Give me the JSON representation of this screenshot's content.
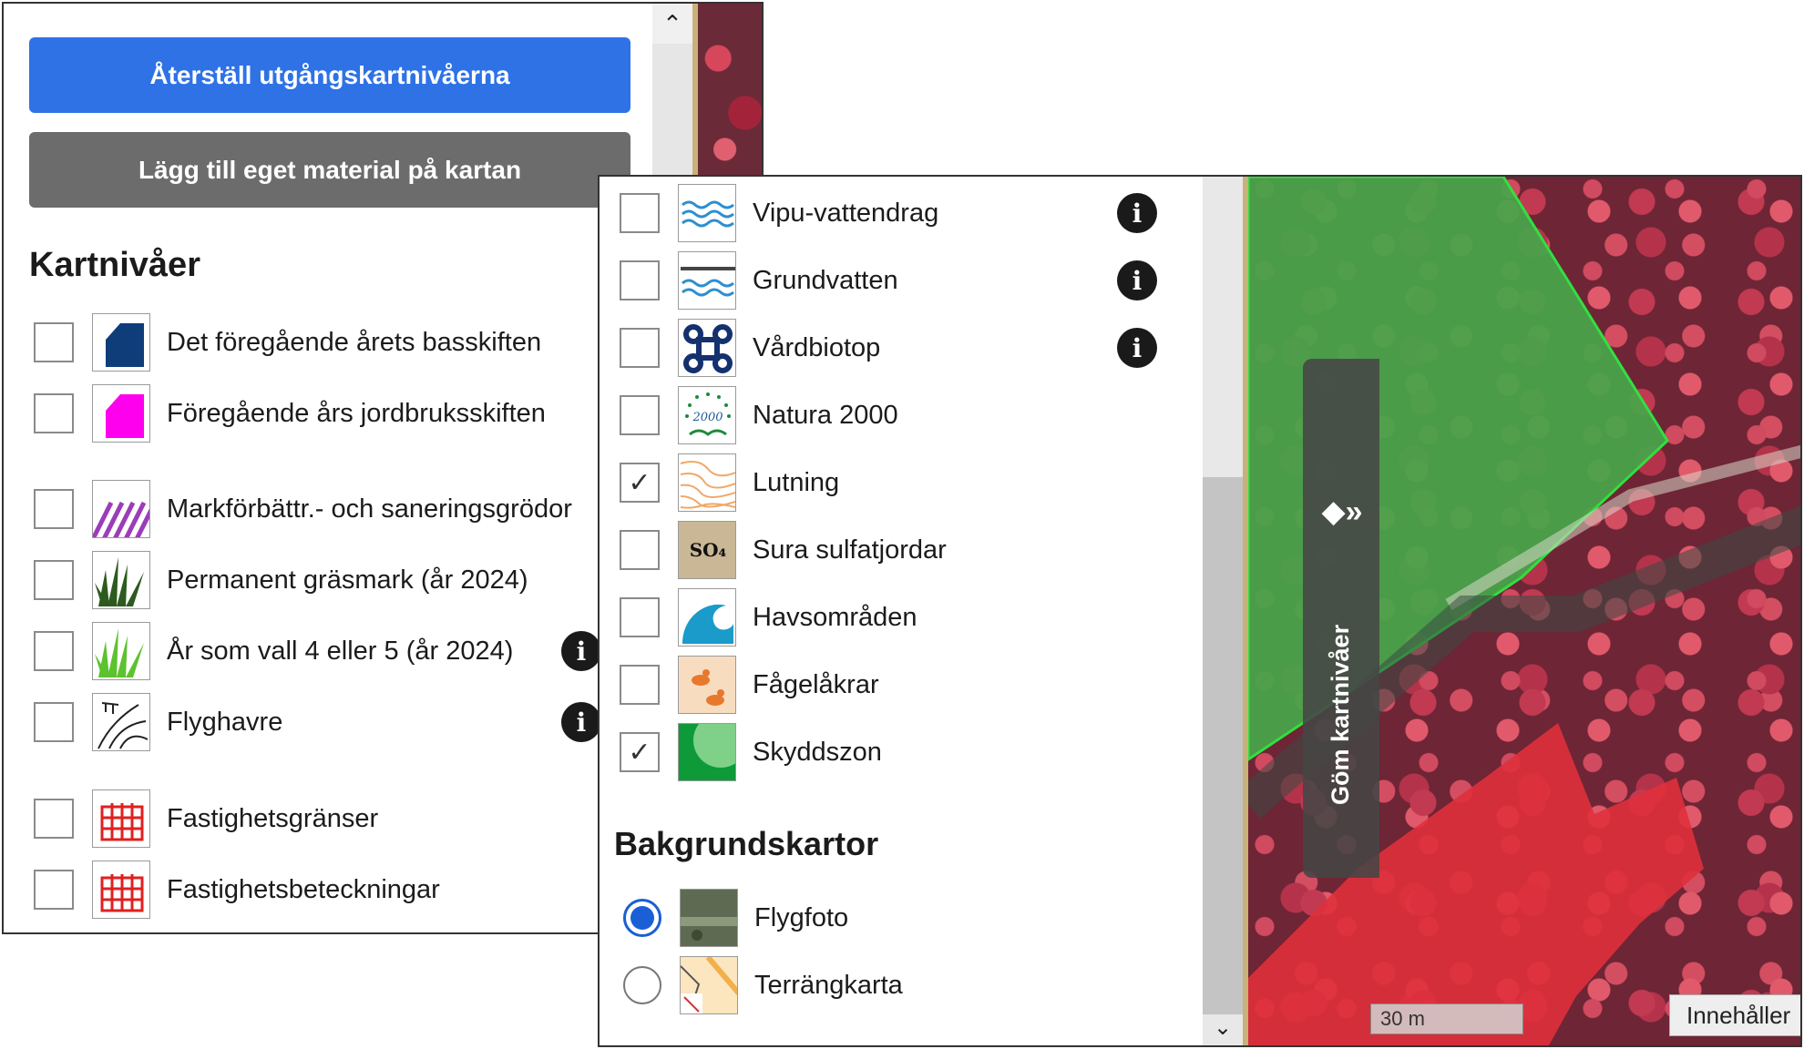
{
  "panel_left": {
    "reset_button": "Återställ utgångskartnivåerna",
    "add_material_button": "Lägg till eget material på kartan",
    "heading": "Kartnivåer",
    "layers": [
      {
        "label": "Det föregående årets basskiften",
        "checked": false,
        "icon": "basskifte-icon",
        "info": false
      },
      {
        "label": "Föregående års jordbruksskiften",
        "checked": false,
        "icon": "jordbruksskifte-icon",
        "info": false
      },
      {
        "label": "Markförbättr.- och saneringsgrödor",
        "checked": false,
        "icon": "hatched-stripes-icon",
        "info": false
      },
      {
        "label": "Permanent gräsmark (år 2024)",
        "checked": false,
        "icon": "dark-grass-icon",
        "info": false
      },
      {
        "label": "År som vall 4 eller 5 (år 2024)",
        "checked": false,
        "icon": "light-grass-icon",
        "info": true
      },
      {
        "label": "Flyghavre",
        "checked": false,
        "icon": "wild-oat-icon",
        "info": true
      },
      {
        "label": "Fastighetsgränser",
        "checked": false,
        "icon": "property-fence-icon",
        "info": false
      },
      {
        "label": "Fastighetsbeteckningar",
        "checked": false,
        "icon": "property-fence-icon",
        "info": false
      }
    ]
  },
  "panel_right": {
    "layers": [
      {
        "label": "Vipu-vattendrag",
        "checked": false,
        "icon": "waves-icon",
        "info": true
      },
      {
        "label": "Grundvatten",
        "checked": false,
        "icon": "groundwater-icon",
        "info": true
      },
      {
        "label": "Vårdbiotop",
        "checked": false,
        "icon": "command-knot-icon",
        "info": true
      },
      {
        "label": "Natura 2000",
        "checked": false,
        "icon": "natura-2000-icon",
        "info": false,
        "icon_text": "2000"
      },
      {
        "label": "Lutning",
        "checked": true,
        "icon": "contour-lines-icon",
        "info": false
      },
      {
        "label": "Sura sulfatjordar",
        "checked": false,
        "icon": "so4-icon",
        "info": false,
        "icon_text": "SO₄"
      },
      {
        "label": "Havsområden",
        "checked": false,
        "icon": "wave-icon",
        "info": false
      },
      {
        "label": "Fågelåkrar",
        "checked": false,
        "icon": "ducks-icon",
        "info": false
      },
      {
        "label": "Skyddszon",
        "checked": true,
        "icon": "protection-zone-icon",
        "info": false
      }
    ],
    "background_heading": "Bakgrundskartor",
    "background_maps": [
      {
        "label": "Flygfoto",
        "selected": true,
        "icon": "aerial-photo-icon"
      },
      {
        "label": "Terrängkarta",
        "selected": false,
        "icon": "terrain-map-icon"
      }
    ]
  },
  "map": {
    "hide_layers_label": "Göm kartnivåer",
    "scale_label": "30 m",
    "content_button": "Innehåller"
  },
  "colors": {
    "primary_button": "#2e72e6",
    "secondary_button": "#6c6c6c",
    "radio_selected": "#1a5fd6",
    "field_green": "#46a64a",
    "highlight_red": "#e0303c"
  }
}
